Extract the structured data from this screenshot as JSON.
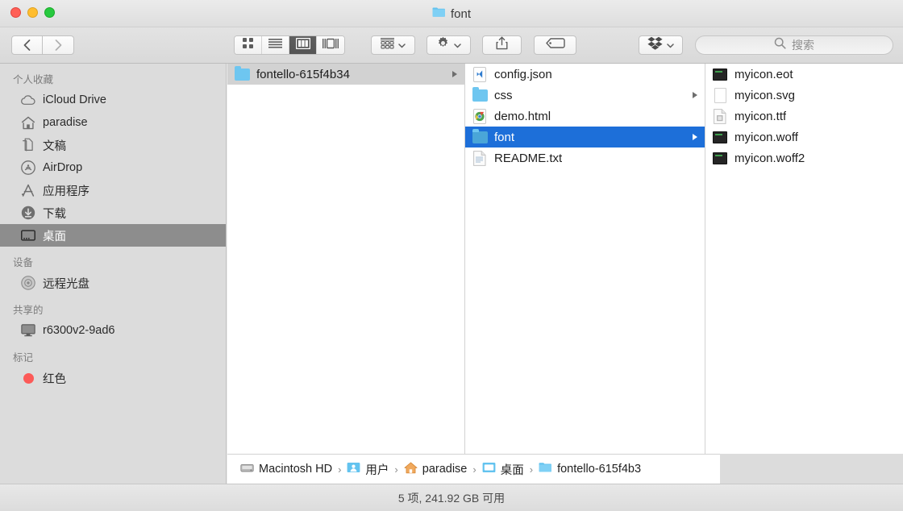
{
  "window": {
    "title": "font",
    "title_icon": "folder-icon",
    "traffic_lights": {
      "close": "close-button",
      "minimize": "minimize-button",
      "maximize": "maximize-button",
      "close_color": "#ff5f56",
      "minimize_color": "#ffbd2e",
      "maximize_color": "#27c93f"
    }
  },
  "toolbar": {
    "back": "back-button",
    "forward": "forward-button",
    "view_modes": [
      {
        "name": "icon-view",
        "label": "icon-grid-icon",
        "active": false
      },
      {
        "name": "list-view",
        "label": "list-icon",
        "active": false
      },
      {
        "name": "column-view",
        "label": "columns-icon",
        "active": true
      },
      {
        "name": "gallery-view",
        "label": "gallery-icon",
        "active": false
      }
    ],
    "arrange": "arrange-icon",
    "action": "gear-icon",
    "share": "share-icon",
    "tags": "tag-icon",
    "dropbox": "dropbox-icon"
  },
  "search": {
    "placeholder": "搜索",
    "value": ""
  },
  "sidebar": {
    "sections": [
      {
        "header": "个人收藏",
        "items": [
          {
            "label": "iCloud Drive",
            "icon": "cloud-icon",
            "selected": false
          },
          {
            "label": "paradise",
            "icon": "home-icon",
            "selected": false
          },
          {
            "label": "文稿",
            "icon": "documents-icon",
            "selected": false
          },
          {
            "label": "AirDrop",
            "icon": "airdrop-icon",
            "selected": false
          },
          {
            "label": "应用程序",
            "icon": "applications-icon",
            "selected": false
          },
          {
            "label": "下载",
            "icon": "downloads-icon",
            "selected": false
          },
          {
            "label": "桌面",
            "icon": "desktop-icon",
            "selected": true
          }
        ]
      },
      {
        "header": "设备",
        "items": [
          {
            "label": "远程光盘",
            "icon": "disc-icon",
            "selected": false
          }
        ]
      },
      {
        "header": "共享的",
        "items": [
          {
            "label": "r6300v2-9ad6",
            "icon": "display-icon",
            "selected": false
          }
        ]
      },
      {
        "header": "标记",
        "items": [
          {
            "label": "红色",
            "icon": "red-tag-dot",
            "color": "#fc5a58",
            "selected": false
          }
        ]
      }
    ]
  },
  "browser": {
    "columns": [
      {
        "name": "column-1",
        "items": [
          {
            "label": "fontello-615f4b34",
            "icon": "folder-icon",
            "selection": "gray",
            "has_arrow": true
          }
        ]
      },
      {
        "name": "column-2",
        "items": [
          {
            "label": "config.json",
            "icon": "vscode-file-icon",
            "selection": "none",
            "has_arrow": false
          },
          {
            "label": "css",
            "icon": "folder-icon",
            "selection": "none",
            "has_arrow": true
          },
          {
            "label": "demo.html",
            "icon": "chrome-file-icon",
            "selection": "none",
            "has_arrow": false
          },
          {
            "label": "font",
            "icon": "folder-icon",
            "selection": "blue",
            "has_arrow": true
          },
          {
            "label": "README.txt",
            "icon": "text-file-icon",
            "selection": "none",
            "has_arrow": false
          }
        ]
      },
      {
        "name": "column-3",
        "items": [
          {
            "label": "myicon.eot",
            "icon": "binary-file-icon",
            "selection": "none",
            "has_arrow": false
          },
          {
            "label": "myicon.svg",
            "icon": "blank-file-icon",
            "selection": "none",
            "has_arrow": false
          },
          {
            "label": "myicon.ttf",
            "icon": "font-file-icon",
            "selection": "none",
            "has_arrow": false
          },
          {
            "label": "myicon.woff",
            "icon": "binary-file-icon",
            "selection": "none",
            "has_arrow": false
          },
          {
            "label": "myicon.woff2",
            "icon": "binary-file-icon",
            "selection": "none",
            "has_arrow": false
          }
        ]
      }
    ]
  },
  "pathbar": {
    "crumbs": [
      {
        "label": "Macintosh HD",
        "icon": "harddisk-icon"
      },
      {
        "label": "用户",
        "icon": "users-folder-icon"
      },
      {
        "label": "paradise",
        "icon": "home-folder-icon"
      },
      {
        "label": "桌面",
        "icon": "desktop-folder-icon"
      },
      {
        "label": "fontello-615f4b3",
        "icon": "folder-icon"
      }
    ],
    "separator": "›"
  },
  "statusbar": {
    "text": "5 项, 241.92 GB 可用"
  }
}
